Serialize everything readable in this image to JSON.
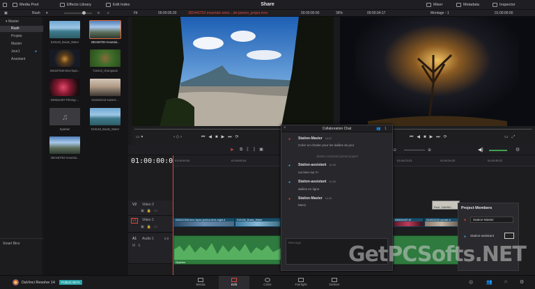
{
  "topbar": {
    "media_pool": "Media Pool",
    "effects_library": "Effects Library",
    "edit_index": "Edit Index",
    "title": "Share",
    "mixer": "Mixer",
    "metadata": "Metadata",
    "inspector": "Inspector"
  },
  "source_bar": {
    "bin_name": "Rush",
    "fit": "Fit",
    "source_tc": "00:00:05:20",
    "clip_name": "282440752-mountain-view-...de-janeiro_projes.mov",
    "clip_tc": "00:00:00:00",
    "zoom": "36%",
    "record_tc": "00:00:34:17",
    "timeline_name": "Montage - 1",
    "timeline_tc": "01:00:00:00"
  },
  "bins": {
    "master": "Master",
    "items": [
      "Rush",
      "Projets",
      "Master",
      "Jour1",
      "Assistant"
    ],
    "smart_bins": "Smart Bins"
  },
  "clips": [
    {
      "label": "519148_Boats_Water"
    },
    {
      "label": "282440752-mountai..."
    },
    {
      "label": "026347546-time-laps..."
    },
    {
      "label": "718413_Orangutan"
    },
    {
      "label": "030624497-Filming-..."
    },
    {
      "label": "031822242-sunset-..."
    },
    {
      "label": "Spartan"
    },
    {
      "label": "519148_Boats_Water"
    },
    {
      "label": "282440752-mountai..."
    }
  ],
  "timeline": {
    "timecode": "01:00:00:00",
    "ruler": [
      "01:00:00:00",
      "01:00:05:24",
      "01:00:23:23",
      "01:00:29:23",
      "01:00:35:22"
    ],
    "tracks": [
      {
        "id": "V2",
        "name": "Video 2"
      },
      {
        "id": "V1",
        "name": "Video 1"
      },
      {
        "id": "A1",
        "name": "Audio 1",
        "level": "2.0"
      }
    ],
    "v1_clips": [
      "026347546-time-lapse-jestrus-time-night-4",
      "519148_Boats_Water",
      "030624497-fil",
      "031822242-sunset-ti"
    ],
    "a1_clip": "Spartan",
    "v2_clip": "Pedl - DAVINC..."
  },
  "chat": {
    "title": "Collaboration Chat",
    "user_count": "1",
    "messages": [
      {
        "name": "Station-Master",
        "time": "14:47",
        "text": "Créer un chutier pour les dailies du jour"
      },
      {
        "system": "Station-assistant joined project"
      },
      {
        "name": "Station-assistant",
        "time": "14:48",
        "text": "oui bien sur !!!"
      },
      {
        "name": "Station-assistant",
        "time": "14:48",
        "text": "dailies en ligne"
      },
      {
        "name": "Station-Master",
        "time": "14:49",
        "text": "Merci"
      }
    ],
    "input_placeholder": "Message"
  },
  "members": {
    "title": "Project Members",
    "list": [
      "Station-Master",
      "Station-assistant"
    ]
  },
  "bottombar": {
    "app_name": "DaVinci Resolve 14",
    "badge": "PUBLIC BETA",
    "pages": [
      "Media",
      "Edit",
      "Color",
      "Fairlight",
      "Deliver"
    ],
    "active_page": "Edit"
  },
  "watermark": "GetPCSofts.NET",
  "colors": {
    "accent": "#e0473c",
    "clip_blue": "#1a4f6b",
    "audio_green": "#3c8c4a"
  }
}
